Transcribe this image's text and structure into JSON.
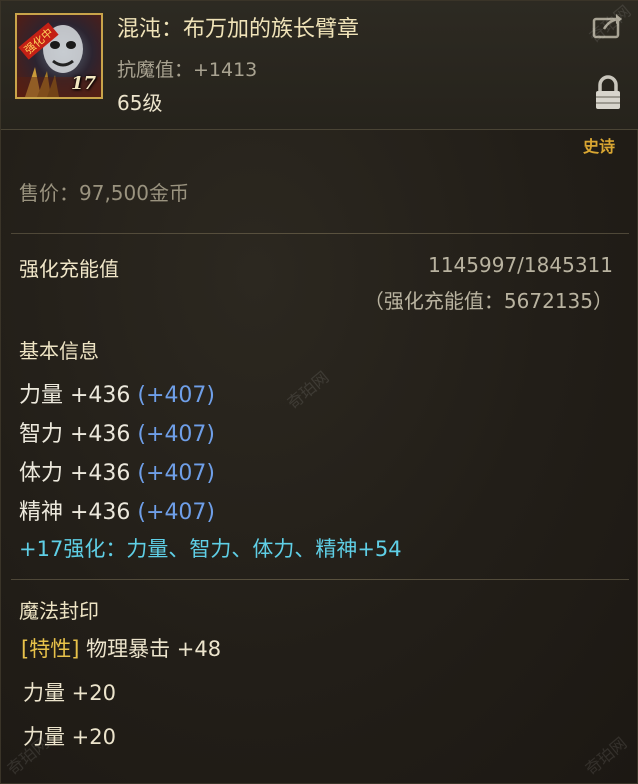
{
  "item": {
    "name": "混沌：布万加的族长臂章",
    "magic_resist": "抗魔值：+1413",
    "level": "65级",
    "icon_level": "17",
    "icon_badge": "强化中",
    "rarity": "史诗"
  },
  "price": "售价：97,500金币",
  "enhancement": {
    "label": "强化充能值",
    "progress": "1145997/1845311",
    "total": "（强化充能值：5672135）"
  },
  "basic_info": {
    "title": "基本信息",
    "stats": [
      {
        "name": "力量 +436",
        "bonus": "(+407)"
      },
      {
        "name": "智力 +436",
        "bonus": "(+407)"
      },
      {
        "name": "体力 +436",
        "bonus": "(+407)"
      },
      {
        "name": "精神 +436",
        "bonus": "(+407)"
      }
    ],
    "enhance_line": "+17强化：力量、智力、体力、精神+54"
  },
  "magic_seal": {
    "title": "魔法封印",
    "trait_tag": "[特性]",
    "trait_desc": "物理暴击 +48",
    "lines": [
      "力量 +20",
      "力量 +20"
    ]
  },
  "icons": {
    "share": "share-icon",
    "lock": "lock-icon"
  },
  "watermark": "奇珀网",
  "colors": {
    "rarity": "#d9a632",
    "bonus_blue": "#6f9fe8",
    "enhance_cyan": "#5fcfe6",
    "trait_gold": "#e8c24a"
  }
}
